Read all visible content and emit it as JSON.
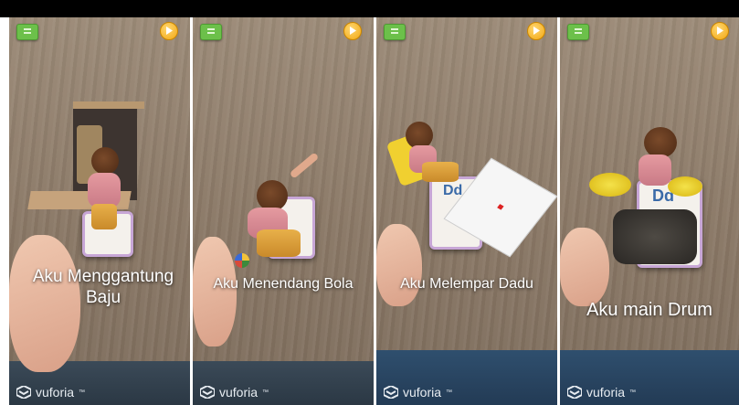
{
  "panels": [
    {
      "caption_line1": "Aku Menggantung",
      "caption_line2": "Baju",
      "menu_icon": "menu-icon",
      "play_icon": "play-icon"
    },
    {
      "caption_line1": "Aku Menendang Bola",
      "caption_line2": "",
      "menu_icon": "menu-icon",
      "play_icon": "play-icon"
    },
    {
      "caption_line1": "Aku Melempar Dadu",
      "caption_line2": "",
      "card_text": "Dd",
      "menu_icon": "menu-icon",
      "play_icon": "play-icon"
    },
    {
      "caption_line1": "Aku main Drum",
      "caption_line2": "",
      "card_text": "Dd",
      "menu_icon": "menu-icon",
      "play_icon": "play-icon"
    }
  ],
  "watermark": "vuforia",
  "colors": {
    "menu": "#6cc04a",
    "play": "#f2a712",
    "card_border": "#c7a6d6"
  }
}
